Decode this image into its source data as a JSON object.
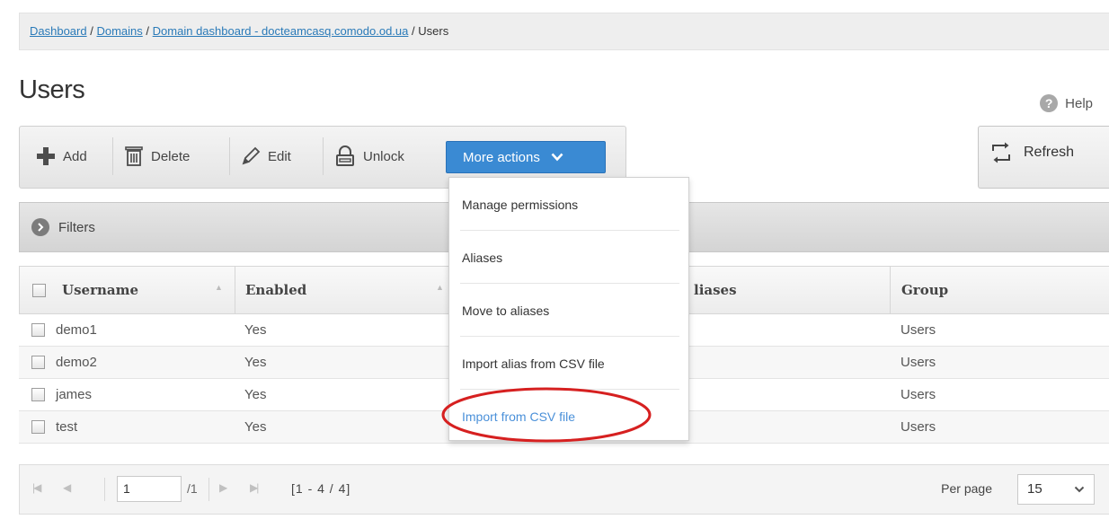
{
  "breadcrumb": {
    "items": [
      "Dashboard",
      "Domains",
      "Domain dashboard - docteamcasq.comodo.od.ua"
    ],
    "current": "Users",
    "separator": "/"
  },
  "page": {
    "title": "Users"
  },
  "help": {
    "label": "Help",
    "icon_glyph": "?"
  },
  "toolbar": {
    "add_label": "Add",
    "delete_label": "Delete",
    "edit_label": "Edit",
    "unlock_label": "Unlock",
    "more_actions_label": "More actions",
    "refresh_label": "Refresh"
  },
  "filters": {
    "label": "Filters"
  },
  "grid": {
    "columns": [
      "Username",
      "Enabled",
      "Aliases",
      "Group"
    ],
    "aliases_visible_fragment": "liases",
    "rows": [
      {
        "username": "demo1",
        "enabled": "Yes",
        "group": "Users"
      },
      {
        "username": "demo2",
        "enabled": "Yes",
        "group": "Users"
      },
      {
        "username": "james",
        "enabled": "Yes",
        "group": "Users"
      },
      {
        "username": "test",
        "enabled": "Yes",
        "group": "Users"
      }
    ]
  },
  "pager": {
    "page_value": "1",
    "total_pages": "/1",
    "range": "[1 - 4 / 4]",
    "per_page_label": "Per page",
    "per_page_value": "15"
  },
  "dropdown": {
    "items": [
      "Manage permissions",
      "Aliases",
      "Move to aliases",
      "Import alias from CSV file",
      "Import from CSV file"
    ]
  },
  "colors": {
    "accent": "#3a8ad3",
    "link": "#2a7ab8",
    "highlight_item": "#4a90d9",
    "annotation_circle": "#d62020"
  },
  "icons": [
    "plus-icon",
    "trash-icon",
    "pencil-icon",
    "padlock-icon",
    "chevron-down-icon",
    "refresh-icon",
    "help-icon",
    "filter-arrow-icon"
  ]
}
